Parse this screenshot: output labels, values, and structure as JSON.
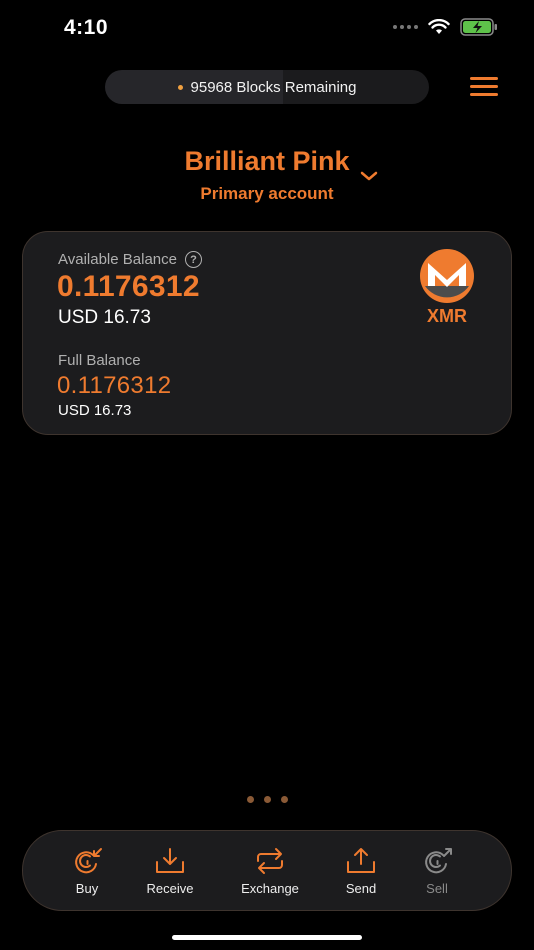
{
  "status_bar": {
    "time": "4:10"
  },
  "sync": {
    "text": "95968 Blocks Remaining"
  },
  "wallet": {
    "name": "Brilliant Pink",
    "account": "Primary account"
  },
  "balance": {
    "available_label": "Available Balance",
    "help_glyph": "?",
    "available_amount": "0.1176312",
    "available_usd": "USD 16.73",
    "full_label": "Full Balance",
    "full_amount": "0.1176312",
    "full_usd": "USD 16.73",
    "ticker": "XMR"
  },
  "actions": [
    {
      "label": "Buy",
      "icon": "buy-icon"
    },
    {
      "label": "Receive",
      "icon": "receive-icon"
    },
    {
      "label": "Exchange",
      "icon": "exchange-icon"
    },
    {
      "label": "Send",
      "icon": "send-icon"
    },
    {
      "label": "Sell",
      "icon": "sell-icon"
    }
  ],
  "colors": {
    "accent": "#ef7b2f",
    "card": "#1c1c1e",
    "background": "#000000",
    "disabled": "#8a8a8a"
  }
}
